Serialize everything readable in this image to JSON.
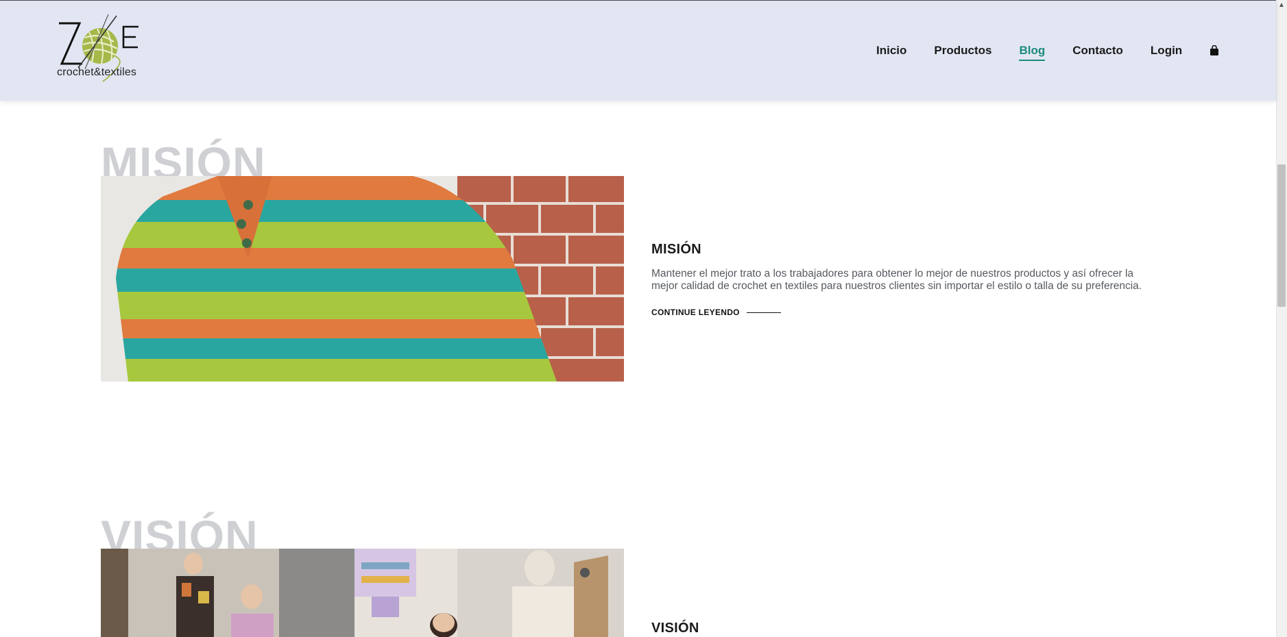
{
  "brand": {
    "logo_letters": "ZoE",
    "subtitle": "crochet&textiles"
  },
  "nav": {
    "items": [
      {
        "label": "Inicio",
        "active": false
      },
      {
        "label": "Productos",
        "active": false
      },
      {
        "label": "Blog",
        "active": true
      },
      {
        "label": "Contacto",
        "active": false
      },
      {
        "label": "Login",
        "active": false
      }
    ],
    "cart_icon": "shopping-bag-icon"
  },
  "posts": [
    {
      "watermark": "MISIÓN",
      "title": "MISIÓN",
      "text": "Mantener el mejor trato a los trabajadores para obtener lo mejor de nuestros productos y así ofrecer la mejor calidad de crochet en textiles para nuestros clientes sin importar el estilo o talla de su preferencia.",
      "read_more": "CONTINUE LEYENDO"
    },
    {
      "watermark": "VISIÓN",
      "title": "VISIÓN"
    }
  ],
  "colors": {
    "header_bg": "#e2e6f3",
    "accent": "#1b8a7c",
    "watermark": "#cfd0d4"
  }
}
